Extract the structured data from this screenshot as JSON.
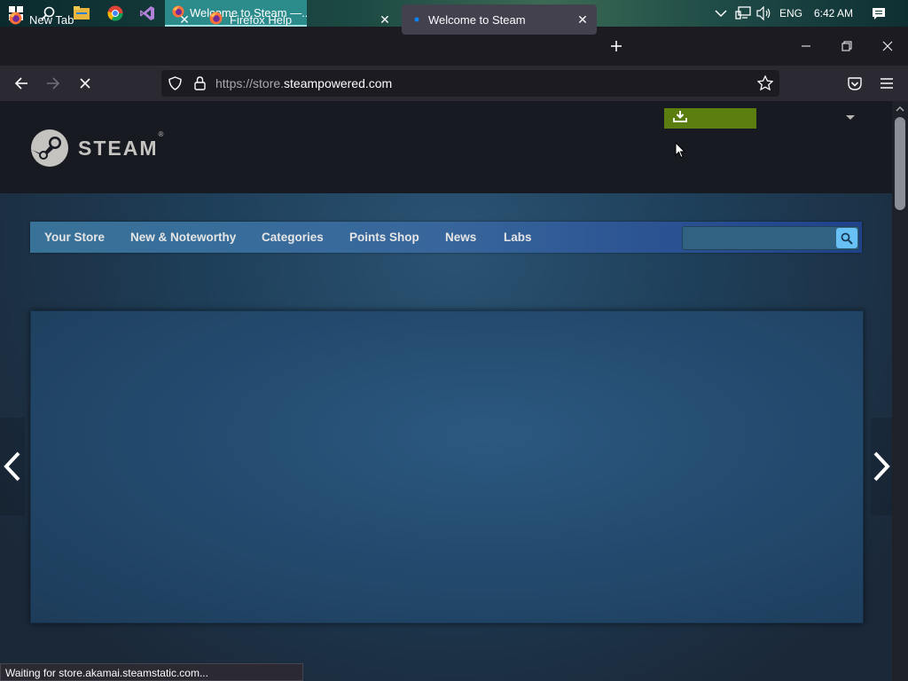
{
  "taskbar": {
    "active_app_title": "Welcome to Steam —...",
    "language": "ENG",
    "time": "6:42 AM",
    "icons": [
      "windows-start-icon",
      "search-icon",
      "file-explorer-icon",
      "chrome-icon",
      "visual-studio-icon"
    ]
  },
  "tabs": [
    {
      "title": "New Tab",
      "icon": "firefox-icon",
      "active": false
    },
    {
      "title": "Firefox Help",
      "icon": "firefox-icon",
      "active": false
    },
    {
      "title": "Welcome to Steam",
      "icon": "loading-dot-icon",
      "active": true
    }
  ],
  "urlbar": {
    "url_prefix": "https://store.",
    "url_domain": "steampowered.com"
  },
  "steam": {
    "logo_text": "STEAM",
    "nav": [
      "Your Store",
      "New & Noteworthy",
      "Categories",
      "Points Shop",
      "News",
      "Labs"
    ],
    "search_placeholder": ""
  },
  "status_text": "Waiting for store.akamai.steamstatic.com...",
  "colors": {
    "install_button": "#5c7e10",
    "search_button": "#67c1f5",
    "header_bg": "#171a21",
    "page_bg": "#1b2838"
  }
}
